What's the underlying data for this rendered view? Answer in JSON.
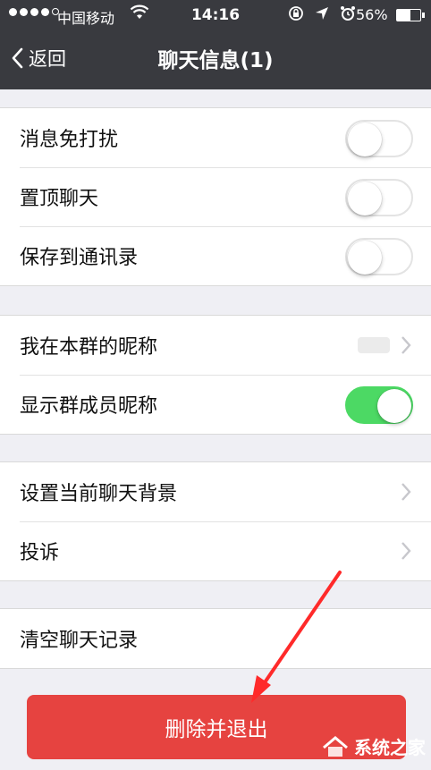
{
  "status_bar": {
    "carrier": "中国移动",
    "time": "14:16",
    "battery": "56%"
  },
  "nav": {
    "back_label": "返回",
    "title": "聊天信息(1)"
  },
  "settings": {
    "mute_label": "消息免打扰",
    "mute_on": false,
    "pin_label": "置顶聊天",
    "pin_on": false,
    "save_contacts_label": "保存到通讯录",
    "save_contacts_on": false,
    "my_nickname_label": "我在本群的昵称",
    "show_nicknames_label": "显示群成员昵称",
    "show_nicknames_on": true,
    "background_label": "设置当前聊天背景",
    "complain_label": "投诉",
    "clear_history_label": "清空聊天记录"
  },
  "actions": {
    "delete_exit_label": "删除并退出"
  },
  "watermark": {
    "text": "系统之家"
  },
  "colors": {
    "nav_bg": "#393a3f",
    "switch_on": "#4cd964",
    "danger": "#e64340",
    "arrow": "#ff2a2a"
  }
}
